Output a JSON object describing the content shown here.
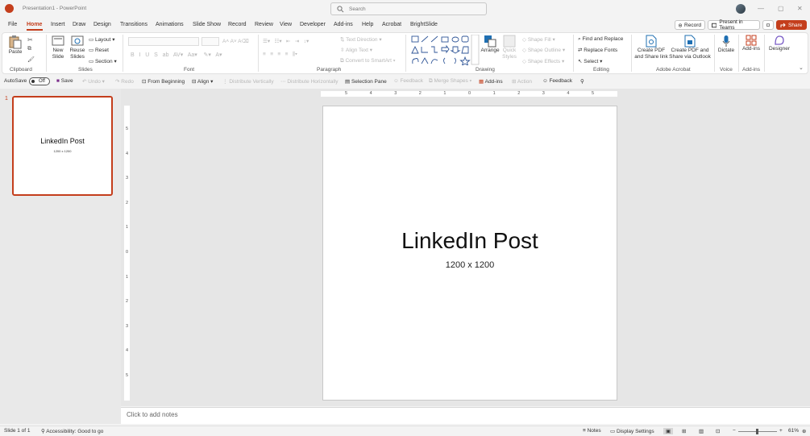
{
  "window": {
    "doc_title": "Presentation1  -  PowerPoint"
  },
  "search": {
    "placeholder": "Search"
  },
  "menu": {
    "tabs": [
      "File",
      "Home",
      "Insert",
      "Draw",
      "Design",
      "Transitions",
      "Animations",
      "Slide Show",
      "Record",
      "Review",
      "View",
      "Developer",
      "Add-ins",
      "Help",
      "Acrobat",
      "BrightSlide"
    ]
  },
  "top_buttons": {
    "record": "Record",
    "present": "Present in Teams",
    "share": "Share"
  },
  "ribbon": {
    "clipboard": {
      "paste": "Paste",
      "group": "Clipboard"
    },
    "slides": {
      "new_slide": "New Slide",
      "reuse": "Reuse Slides",
      "layout": "Layout",
      "reset": "Reset",
      "section": "Section",
      "group": "Slides"
    },
    "font": {
      "group": "Font"
    },
    "paragraph": {
      "text_direction": "Text Direction",
      "align_text": "Align Text",
      "convert": "Convert to SmartArt",
      "group": "Paragraph"
    },
    "drawing": {
      "arrange": "Arrange",
      "quick_styles": "Quick Styles",
      "shape_fill": "Shape Fill",
      "shape_outline": "Shape Outline",
      "shape_effects": "Shape Effects",
      "group": "Drawing"
    },
    "editing": {
      "find": "Find and Replace",
      "replace": "Replace Fonts",
      "select": "Select",
      "group": "Editing"
    },
    "acrobat": {
      "create_pdf": "Create PDF and Share link",
      "create_pdf_outlook": "Create PDF and Share via Outlook",
      "group": "Adobe Acrobat"
    },
    "voice": {
      "dictate": "Dictate",
      "group": "Voice"
    },
    "addins": {
      "label": "Add-ins",
      "group": "Add-ins"
    },
    "designer": {
      "label": "Designer"
    }
  },
  "qat": {
    "autosave": "AutoSave",
    "toggle": "Off",
    "save": "Save",
    "undo": "Undo",
    "redo": "Redo",
    "from_beginning": "From Beginning",
    "align": "Align",
    "dist_v": "Distribute Vertically",
    "dist_h": "Distribute Horizontally",
    "selection_pane": "Selection Pane",
    "feedback1": "Feedback",
    "merge_shapes": "Merge Shapes",
    "addins": "Add-ins",
    "action": "Action",
    "feedback2": "Feedback"
  },
  "thumbnail": {
    "number": "1",
    "title": "LinkedIn Post",
    "subtitle": "1200 x 1200"
  },
  "slide": {
    "title": "LinkedIn Post",
    "subtitle": "1200 x 1200"
  },
  "notes": {
    "placeholder": "Click to add notes"
  },
  "status": {
    "slide_count": "Slide 1 of 1",
    "accessibility": "Accessibility: Good to go",
    "notes": "Notes",
    "display": "Display Settings",
    "zoom": "61%"
  },
  "ruler": {
    "h_ticks": [
      "6",
      "5",
      "4",
      "3",
      "2",
      "1",
      "0",
      "1",
      "2",
      "3",
      "4",
      "5",
      "6"
    ],
    "v_ticks": [
      "6",
      "5",
      "4",
      "3",
      "2",
      "1",
      "0",
      "1",
      "2",
      "3",
      "4",
      "5",
      "6"
    ]
  },
  "colors": {
    "accent": "#c43e1c"
  }
}
